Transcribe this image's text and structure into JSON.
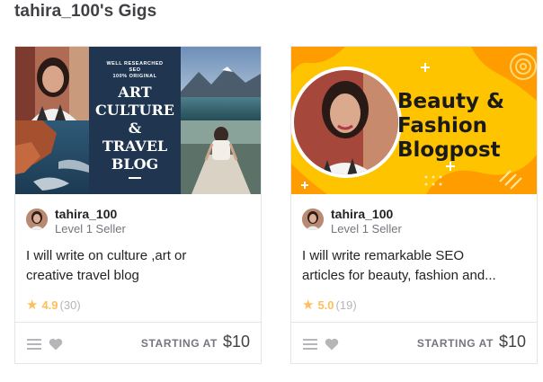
{
  "section": {
    "title": "tahira_100's Gigs"
  },
  "gigs": [
    {
      "thumb": {
        "small_lines": [
          "WELL RESEARCHED",
          "SEO",
          "100% ORIGINAL"
        ],
        "big_lines": [
          "ART",
          "CULTURE",
          "&",
          "TRAVEL",
          "BLOG"
        ]
      },
      "seller": {
        "name": "tahira_100",
        "level": "Level 1 Seller"
      },
      "title_lines": [
        "I will write on culture ,art or",
        "creative travel blog"
      ],
      "rating": {
        "score": "4.9",
        "count": "(30)"
      },
      "price": {
        "label": "STARTING AT",
        "amount": "$10"
      }
    },
    {
      "thumb": {
        "big_lines": [
          "Beauty &",
          "Fashion",
          "Blogpost"
        ]
      },
      "seller": {
        "name": "tahira_100",
        "level": "Level 1 Seller"
      },
      "title_lines": [
        "I will write remarkable SEO",
        "articles for beauty, fashion and..."
      ],
      "rating": {
        "score": "5.0",
        "count": "(19)"
      },
      "price": {
        "label": "STARTING AT",
        "amount": "$10"
      }
    }
  ],
  "icons": {
    "collections": "list-icon",
    "favorite": "heart-icon",
    "star": "star-icon"
  },
  "colors": {
    "star": "#ffbe5b",
    "blog_navy": "#1f3550",
    "beauty_yellow": "#ffc400",
    "border": "#e4e5e7"
  }
}
